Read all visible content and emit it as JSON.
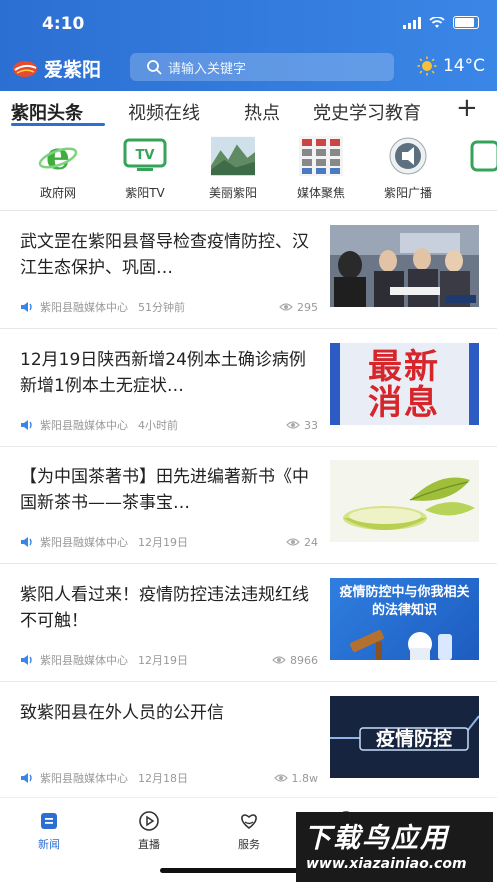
{
  "status_bar": {
    "time": "4:10"
  },
  "header": {
    "logo_text": "爱紫阳",
    "search_placeholder": "请输入关键字",
    "weather": {
      "icon": "sun-icon",
      "temperature": "14°C"
    }
  },
  "tabs": [
    {
      "label": "紫阳头条",
      "active": true
    },
    {
      "label": "视频在线"
    },
    {
      "label": "热点"
    },
    {
      "label": "党史学习教育"
    }
  ],
  "channels": [
    {
      "label": "政府网",
      "icon": "ie-browser-icon"
    },
    {
      "label": "紫阳TV",
      "icon": "tv-icon"
    },
    {
      "label": "美丽紫阳",
      "icon": "landscape-photo-icon"
    },
    {
      "label": "媒体聚焦",
      "icon": "media-grid-icon"
    },
    {
      "label": "紫阳广播",
      "icon": "broadcast-icon"
    }
  ],
  "news": [
    {
      "title": "武文罡在紫阳县督导检查疫情防控、汉江生态保护、巩固…",
      "source": "紫阳县融媒体中心",
      "time": "51分钟前",
      "views": "295",
      "thumb": "officials-photo"
    },
    {
      "title": "12月19日陕西新增24例本土确诊病例 新增1例本土无症状…",
      "source": "紫阳县融媒体中心",
      "time": "4小时前",
      "views": "33",
      "thumb_text": "最新消息"
    },
    {
      "title": "【为中国茶著书】田先进编著新书《中国新茶书——茶事宝…",
      "source": "紫阳县融媒体中心",
      "time": "12月19日",
      "views": "24",
      "thumb": "tea-illustration"
    },
    {
      "title": "紫阳人看过来！疫情防控违法违规红线不可触！",
      "source": "紫阳县融媒体中心",
      "time": "12月19日",
      "views": "8966",
      "thumb_text": "疫情防控中与你我相关的法律知识"
    },
    {
      "title": "致紫阳县在外人员的公开信",
      "source": "紫阳县融媒体中心",
      "time": "12月18日",
      "views": "1.8w",
      "thumb_text": "疫情防控"
    }
  ],
  "bottom_nav": [
    {
      "label": "新闻",
      "icon": "news-icon",
      "active": true
    },
    {
      "label": "直播",
      "icon": "play-icon"
    },
    {
      "label": "服务",
      "icon": "service-icon"
    }
  ],
  "watermark": {
    "line1": "下载鸟应用",
    "line2": "www.xiazainiao.com"
  },
  "colors": {
    "brand_blue": "#2c6fd3",
    "header_blue": "#3a86e6"
  }
}
